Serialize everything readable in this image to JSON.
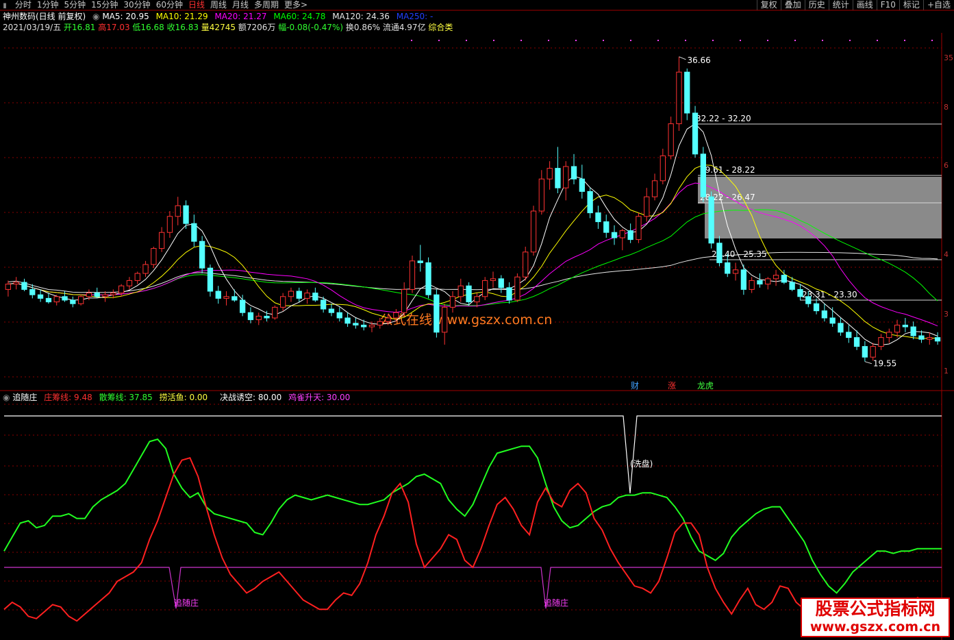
{
  "toolbar": {
    "tabs": [
      "分时",
      "1分钟",
      "5分钟",
      "15分钟",
      "30分钟",
      "60分钟",
      "日线",
      "周线",
      "月线",
      "多周期",
      "更多>"
    ],
    "active_index": 6,
    "right": [
      "复权",
      "叠加",
      "历史",
      "统计",
      "画线",
      "F10",
      "标记",
      "+自选"
    ]
  },
  "header": {
    "stock": "神州数码(日线 前复权)",
    "ma5": "MA5: 20.95",
    "ma10": "MA10: 21.29",
    "ma20": "MA20: 21.27",
    "ma60": "MA60: 24.78",
    "ma120": "MA120: 24.36",
    "ma250": "MA250: -",
    "date": "2021/03/19/五",
    "open": "开16.81",
    "high": "高17.03",
    "low": "低16.68",
    "close": "收16.83",
    "vol": "量42745",
    "amt": "额7206万",
    "chg": "幅-0.08(-0.47%)",
    "turn": "换0.86%",
    "float": "流通4.97亿",
    "cat": "综合类"
  },
  "indicator_header": {
    "name": "追随庄",
    "zhuang": "庄筹线: 9.48",
    "san": "散筹线: 37.85",
    "fish": "捞活鱼: 0.00",
    "battle": "决战诱空: 80.00",
    "bird": "鸡雀升天: 30.00"
  },
  "colors": {
    "up": "#ff3232",
    "down": "#54ffff",
    "ma5": "#ffffff",
    "ma10": "#ffff00",
    "ma20": "#ff00ff",
    "ma60": "#00ff00",
    "ma120": "#e8e8e8",
    "grid": "#8b0000",
    "zhuang": "#ff2020",
    "san": "#20ff20",
    "flat": "#cc33cc",
    "white": "#ffffff"
  },
  "price_labels": {
    "high": "36.66",
    "low": "19.55",
    "zone1": "32.22 - 32.20",
    "zone2": "29.61 - 28.22",
    "zone3": "28.22 - 26.47",
    "zone4": "25.40 - 25.35",
    "zone5": "23.31 - 23.30"
  },
  "axis_right": [
    "35",
    "8",
    "6",
    "4",
    "3",
    "1"
  ],
  "event_markers": [
    "财",
    "涨",
    "龙虎"
  ],
  "indicator_labels": {
    "wash": "(洗盘)",
    "follow1": "追随庄",
    "follow2": "追随庄"
  },
  "watermark": {
    "center": "公式在线 www.gszx.com.cn",
    "box_line1": "股票公式指标网",
    "box_line2": "www.gszx.com.cn"
  },
  "chart_data": {
    "type": "candlestick",
    "ylim": [
      18,
      38
    ],
    "candles": [
      [
        23.6,
        24.1,
        23.2,
        23.9
      ],
      [
        23.9,
        24.3,
        23.6,
        24.0
      ],
      [
        24.0,
        24.2,
        23.5,
        23.6
      ],
      [
        23.6,
        23.9,
        23.1,
        23.3
      ],
      [
        23.3,
        23.6,
        22.9,
        23.1
      ],
      [
        23.1,
        23.4,
        22.8,
        22.9
      ],
      [
        22.9,
        23.3,
        22.7,
        23.2
      ],
      [
        23.2,
        23.5,
        22.9,
        23.0
      ],
      [
        23.0,
        23.2,
        22.6,
        22.8
      ],
      [
        22.8,
        23.3,
        22.7,
        23.2
      ],
      [
        23.2,
        23.6,
        23.0,
        23.4
      ],
      [
        23.4,
        23.7,
        23.1,
        23.2
      ],
      [
        23.2,
        23.5,
        22.9,
        23.3
      ],
      [
        23.3,
        23.6,
        23.1,
        23.4
      ],
      [
        23.4,
        23.9,
        23.2,
        23.8
      ],
      [
        23.8,
        24.3,
        23.6,
        24.1
      ],
      [
        24.1,
        24.6,
        23.9,
        24.5
      ],
      [
        24.5,
        25.2,
        24.3,
        25.0
      ],
      [
        25.0,
        26.0,
        24.8,
        25.9
      ],
      [
        25.9,
        27.1,
        25.7,
        26.8
      ],
      [
        26.8,
        28.0,
        26.5,
        27.7
      ],
      [
        27.7,
        28.8,
        27.2,
        28.3
      ],
      [
        28.3,
        28.6,
        27.0,
        27.3
      ],
      [
        27.3,
        27.8,
        26.0,
        26.3
      ],
      [
        26.3,
        26.6,
        24.5,
        24.8
      ],
      [
        24.8,
        25.0,
        23.2,
        23.5
      ],
      [
        23.5,
        23.8,
        22.8,
        23.1
      ],
      [
        23.1,
        23.5,
        22.7,
        23.2
      ],
      [
        23.2,
        23.6,
        22.9,
        23.0
      ],
      [
        23.0,
        23.3,
        22.1,
        22.3
      ],
      [
        22.3,
        22.6,
        21.7,
        21.9
      ],
      [
        21.9,
        22.3,
        21.6,
        22.1
      ],
      [
        22.1,
        22.4,
        21.8,
        22.0
      ],
      [
        22.0,
        22.7,
        21.9,
        22.6
      ],
      [
        22.6,
        23.4,
        22.4,
        23.2
      ],
      [
        23.2,
        23.7,
        22.9,
        23.5
      ],
      [
        23.5,
        23.7,
        22.9,
        23.1
      ],
      [
        23.1,
        23.6,
        22.8,
        23.4
      ],
      [
        23.4,
        23.7,
        22.9,
        23.0
      ],
      [
        23.0,
        23.2,
        22.3,
        22.5
      ],
      [
        22.5,
        22.8,
        22.1,
        22.3
      ],
      [
        22.3,
        22.6,
        21.8,
        22.0
      ],
      [
        22.0,
        22.3,
        21.5,
        21.7
      ],
      [
        21.7,
        22.0,
        21.4,
        21.6
      ],
      [
        21.6,
        21.9,
        21.3,
        21.5
      ],
      [
        21.5,
        21.8,
        21.2,
        21.6
      ],
      [
        21.6,
        22.0,
        21.4,
        21.8
      ],
      [
        21.8,
        22.2,
        21.6,
        22.0
      ],
      [
        22.0,
        22.5,
        21.8,
        22.3
      ],
      [
        22.3,
        24.0,
        22.1,
        23.6
      ],
      [
        23.6,
        25.5,
        23.4,
        25.2
      ],
      [
        25.2,
        26.1,
        24.6,
        25.1
      ],
      [
        25.1,
        25.4,
        23.1,
        23.3
      ],
      [
        23.3,
        23.6,
        20.9,
        21.2
      ],
      [
        21.2,
        22.8,
        20.5,
        22.6
      ],
      [
        22.6,
        23.5,
        22.3,
        23.2
      ],
      [
        23.2,
        24.2,
        22.9,
        23.8
      ],
      [
        23.8,
        24.0,
        22.7,
        22.9
      ],
      [
        22.9,
        23.4,
        22.6,
        23.2
      ],
      [
        23.2,
        24.3,
        23.0,
        24.1
      ],
      [
        24.1,
        24.6,
        23.7,
        24.2
      ],
      [
        24.2,
        24.4,
        23.4,
        23.7
      ],
      [
        23.7,
        24.0,
        22.8,
        23.0
      ],
      [
        23.0,
        24.5,
        22.9,
        24.3
      ],
      [
        24.3,
        26.0,
        24.1,
        25.7
      ],
      [
        25.7,
        28.3,
        25.5,
        28.0
      ],
      [
        28.0,
        30.3,
        27.8,
        29.8
      ],
      [
        29.8,
        30.8,
        29.2,
        30.4
      ],
      [
        30.4,
        31.6,
        29.0,
        29.3
      ],
      [
        29.3,
        30.8,
        28.6,
        30.5
      ],
      [
        30.5,
        31.2,
        29.5,
        29.8
      ],
      [
        29.8,
        30.6,
        28.7,
        29.1
      ],
      [
        29.1,
        29.3,
        27.6,
        27.9
      ],
      [
        27.9,
        28.3,
        27.0,
        27.4
      ],
      [
        27.4,
        27.8,
        26.5,
        26.8
      ],
      [
        26.8,
        27.2,
        26.1,
        26.5
      ],
      [
        26.5,
        27.0,
        25.8,
        26.9
      ],
      [
        26.9,
        27.3,
        26.2,
        26.4
      ],
      [
        26.4,
        27.9,
        26.2,
        27.7
      ],
      [
        27.7,
        29.3,
        27.4,
        28.8
      ],
      [
        28.8,
        30.1,
        28.6,
        29.7
      ],
      [
        29.7,
        31.5,
        29.5,
        31.1
      ],
      [
        31.1,
        33.3,
        30.9,
        32.9
      ],
      [
        32.9,
        36.66,
        32.5,
        35.8
      ],
      [
        35.8,
        36.0,
        33.1,
        33.5
      ],
      [
        33.5,
        33.9,
        31.0,
        31.2
      ],
      [
        31.2,
        31.6,
        28.5,
        28.8
      ],
      [
        28.8,
        29.1,
        25.9,
        26.2
      ],
      [
        26.2,
        26.6,
        24.9,
        25.1
      ],
      [
        25.1,
        25.6,
        24.3,
        24.5
      ],
      [
        24.5,
        25.1,
        24.1,
        24.7
      ],
      [
        24.7,
        25.0,
        23.3,
        23.6
      ],
      [
        23.6,
        24.3,
        23.4,
        24.1
      ],
      [
        24.1,
        24.5,
        23.7,
        23.9
      ],
      [
        23.9,
        24.3,
        23.6,
        24.2
      ],
      [
        24.2,
        24.7,
        23.8,
        24.4
      ],
      [
        24.4,
        24.7,
        23.9,
        24.0
      ],
      [
        24.0,
        24.3,
        23.5,
        23.6
      ],
      [
        23.6,
        23.9,
        23.0,
        23.2
      ],
      [
        23.2,
        23.5,
        22.6,
        22.8
      ],
      [
        22.8,
        23.1,
        22.2,
        22.4
      ],
      [
        22.4,
        22.8,
        21.8,
        22.0
      ],
      [
        22.0,
        22.6,
        21.5,
        21.7
      ],
      [
        21.7,
        22.0,
        21.0,
        21.2
      ],
      [
        21.2,
        21.6,
        20.6,
        20.9
      ],
      [
        20.9,
        21.3,
        20.2,
        20.4
      ],
      [
        20.4,
        20.7,
        19.55,
        19.8
      ],
      [
        19.8,
        20.6,
        19.6,
        20.4
      ],
      [
        20.4,
        21.1,
        20.2,
        20.9
      ],
      [
        20.9,
        21.4,
        20.6,
        21.2
      ],
      [
        21.2,
        21.9,
        20.9,
        21.6
      ],
      [
        21.6,
        22.0,
        21.2,
        21.5
      ],
      [
        21.5,
        21.8,
        20.8,
        21.0
      ],
      [
        21.0,
        21.3,
        20.6,
        20.8
      ],
      [
        20.8,
        21.2,
        20.5,
        20.9
      ],
      [
        20.9,
        21.2,
        20.5,
        20.7
      ]
    ],
    "indicator": {
      "ylim": [
        0,
        100
      ],
      "zhuang": [
        12,
        15,
        13,
        9,
        8,
        11,
        14,
        13,
        9,
        7,
        10,
        13,
        16,
        19,
        24,
        26,
        28,
        32,
        42,
        50,
        60,
        70,
        76,
        77,
        69,
        56,
        44,
        34,
        27,
        23,
        19,
        21,
        24,
        26,
        28,
        24,
        20,
        16,
        14,
        12,
        12,
        16,
        19,
        18,
        23,
        32,
        44,
        52,
        62,
        66,
        58,
        40,
        30,
        34,
        38,
        44,
        42,
        33,
        30,
        38,
        48,
        57,
        60,
        55,
        48,
        44,
        58,
        64,
        58,
        56,
        63,
        66,
        62,
        51,
        46,
        38,
        32,
        27,
        22,
        21,
        19,
        24,
        34,
        45,
        49,
        49,
        44,
        30,
        21,
        15,
        10,
        16,
        21,
        14,
        12,
        15,
        22,
        21,
        15,
        12,
        10,
        14,
        12,
        9,
        7,
        10,
        14,
        13,
        16,
        11,
        7,
        10,
        12,
        17,
        16,
        13,
        12
      ],
      "san": [
        37,
        43,
        49,
        50,
        47,
        48,
        52,
        52,
        53,
        51,
        51,
        56,
        59,
        61,
        63,
        66,
        72,
        78,
        84,
        85,
        81,
        70,
        64,
        60,
        62,
        56,
        53,
        52,
        51,
        50,
        49,
        45,
        44,
        49,
        55,
        59,
        61,
        60,
        59,
        60,
        61,
        60,
        59,
        58,
        57,
        57,
        58,
        59,
        62,
        64,
        66,
        69,
        70,
        68,
        66,
        59,
        55,
        52,
        57,
        65,
        73,
        79,
        80,
        81,
        82,
        82,
        77,
        66,
        56,
        50,
        47,
        48,
        51,
        54,
        56,
        57,
        60,
        61,
        61,
        62,
        62,
        61,
        60,
        56,
        51,
        43,
        37,
        35,
        33,
        36,
        43,
        47,
        50,
        53,
        55,
        56,
        56,
        51,
        46,
        41,
        33,
        27,
        22,
        19,
        23,
        28,
        31,
        34,
        37,
        37,
        36,
        37,
        37,
        38,
        38,
        38,
        38
      ],
      "flat": 30,
      "white_top": 95
    }
  }
}
